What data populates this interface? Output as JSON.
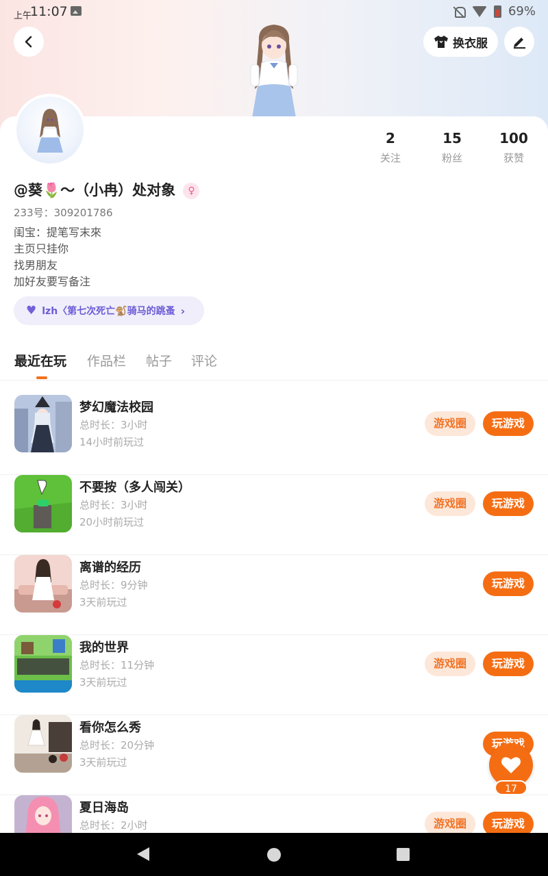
{
  "status_bar": {
    "ampm": "上午",
    "time": "11:07",
    "battery": "69%"
  },
  "header": {
    "outfit_label": "换衣服"
  },
  "stats": [
    {
      "value": "2",
      "label": "关注"
    },
    {
      "value": "15",
      "label": "粉丝"
    },
    {
      "value": "100",
      "label": "获赞"
    }
  ],
  "profile": {
    "nickname": "@葵🌷～（小冉）处对象",
    "gender_symbol": "♀",
    "uid": "233号：309201786",
    "bio": [
      "闺宝：提笔写末來",
      "主页只挂你",
      "找男朋友",
      "加好友要写备注"
    ],
    "club": "lzh〈第七次死亡🐒骑马的跳蚤"
  },
  "tabs": [
    "最近在玩",
    "作品栏",
    "帖子",
    "评论"
  ],
  "game_buttons": {
    "circle": "游戏圈",
    "play": "玩游戏"
  },
  "games": [
    {
      "name": "梦幻魔法校园",
      "duration": "总时长：3小时",
      "last": "14小时前玩过",
      "has_circle": true,
      "thumb_colors": [
        "#b8c7df",
        "#3a4a6a"
      ]
    },
    {
      "name": "不要按（多人闯关）",
      "duration": "总时长：3小时",
      "last": "20小时前玩过",
      "has_circle": true,
      "thumb_colors": [
        "#5fc03a",
        "#3e8e22"
      ]
    },
    {
      "name": "离谱的经历",
      "duration": "总时长：9分钟",
      "last": "3天前玩过",
      "has_circle": false,
      "thumb_colors": [
        "#f2d6cf",
        "#c99a90"
      ]
    },
    {
      "name": "我的世界",
      "duration": "总时长：11分钟",
      "last": "3天前玩过",
      "has_circle": true,
      "thumb_colors": [
        "#6cbf49",
        "#1e88c9"
      ]
    },
    {
      "name": "看你怎么秀",
      "duration": "总时长：20分钟",
      "last": "3天前玩过",
      "has_circle": false,
      "thumb_colors": [
        "#efe9e2",
        "#b3a293"
      ]
    },
    {
      "name": "夏日海岛",
      "duration": "总时长：2小时",
      "last": "",
      "has_circle": true,
      "thumb_colors": [
        "#f4a6c0",
        "#7ec6e8"
      ]
    }
  ],
  "like": {
    "count": "17"
  }
}
